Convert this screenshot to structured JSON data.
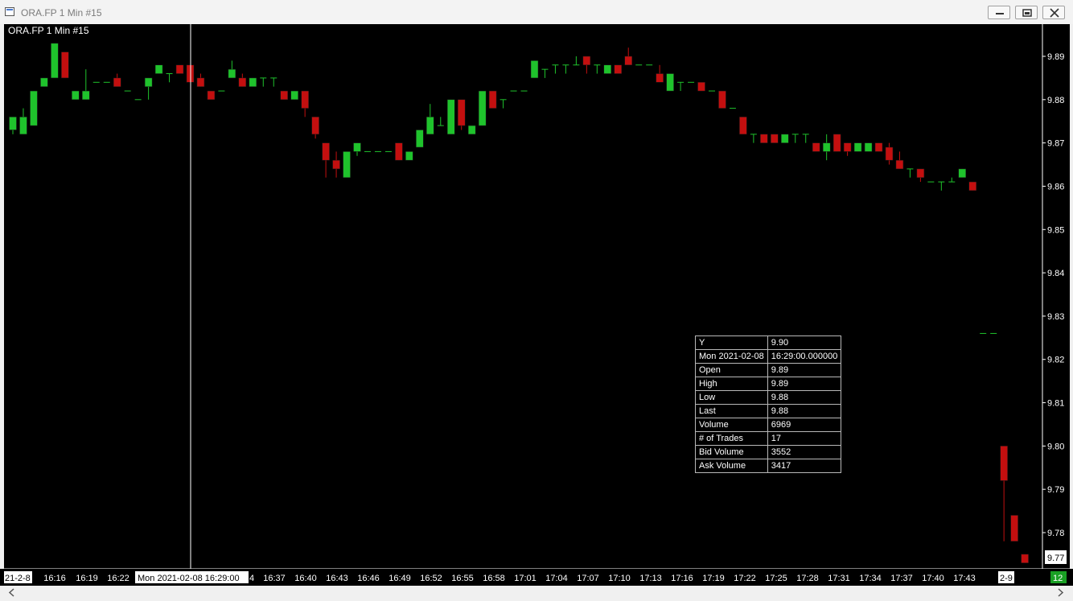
{
  "window": {
    "title": "ORA.FP  1 Min   #15",
    "minimize": "minimize",
    "restore": "restore",
    "close": "close"
  },
  "chart": {
    "label": "ORA.FP  1 Min  #15",
    "price_labels": [
      "9.89",
      "9.88",
      "9.87",
      "9.86",
      "9.85",
      "9.84",
      "9.83",
      "9.82",
      "9.81",
      "9.80",
      "9.79",
      "9.78"
    ],
    "last_price": "9.77",
    "time_labels": [
      "16:16",
      "16:19",
      "16:22",
      "16:37",
      "16:40",
      "16:43",
      "16:46",
      "16:49",
      "16:52",
      "16:55",
      "16:58",
      "17:01",
      "17:04",
      "17:07",
      "17:10",
      "17:13",
      "17:16",
      "17:19",
      "17:22",
      "17:25",
      "17:28",
      "17:31",
      "17:34",
      "17:37",
      "17:40",
      "17:43"
    ],
    "date_left": "21-2-8",
    "date_right": "2-9",
    "cursor_time": "Mon 2021-02-08  16:29:00",
    "cursor_time_suffix": "4",
    "counter": "12",
    "colors": {
      "up": "#1fc32c",
      "down": "#c30f0f",
      "background": "#000000",
      "text": "#ffffff",
      "counter": "#1aa024"
    }
  },
  "chart_data": {
    "type": "candlestick",
    "title": "ORA.FP  1 Min  #15",
    "ylim": [
      9.765,
      9.895
    ],
    "candles": [
      {
        "o": 9.873,
        "h": 9.876,
        "l": 9.872,
        "c": 9.876
      },
      {
        "o": 9.872,
        "h": 9.878,
        "l": 9.872,
        "c": 9.876
      },
      {
        "o": 9.874,
        "h": 9.882,
        "l": 9.874,
        "c": 9.882
      },
      {
        "o": 9.883,
        "h": 9.885,
        "l": 9.883,
        "c": 9.885
      },
      {
        "o": 9.885,
        "h": 9.893,
        "l": 9.885,
        "c": 9.893
      },
      {
        "o": 9.891,
        "h": 9.891,
        "l": 9.885,
        "c": 9.885
      },
      {
        "o": 9.88,
        "h": 9.882,
        "l": 9.88,
        "c": 9.882
      },
      {
        "o": 9.88,
        "h": 9.887,
        "l": 9.88,
        "c": 9.882
      },
      {
        "o": 9.884,
        "h": 9.884,
        "l": 9.884,
        "c": 9.884
      },
      {
        "o": 9.884,
        "h": 9.884,
        "l": 9.884,
        "c": 9.884
      },
      {
        "o": 9.885,
        "h": 9.886,
        "l": 9.883,
        "c": 9.883
      },
      {
        "o": 9.882,
        "h": 9.882,
        "l": 9.882,
        "c": 9.882
      },
      {
        "o": 9.88,
        "h": 9.88,
        "l": 9.88,
        "c": 9.88
      },
      {
        "o": 9.883,
        "h": 9.885,
        "l": 9.88,
        "c": 9.885
      },
      {
        "o": 9.886,
        "h": 9.888,
        "l": 9.886,
        "c": 9.888
      },
      {
        "o": 9.886,
        "h": 9.886,
        "l": 9.884,
        "c": 9.886
      },
      {
        "o": 9.888,
        "h": 9.888,
        "l": 9.886,
        "c": 9.886
      },
      {
        "o": 9.888,
        "h": 9.888,
        "l": 9.884,
        "c": 9.884
      },
      {
        "o": 9.885,
        "h": 9.886,
        "l": 9.883,
        "c": 9.883
      },
      {
        "o": 9.882,
        "h": 9.882,
        "l": 9.88,
        "c": 9.88
      },
      {
        "o": 9.882,
        "h": 9.882,
        "l": 9.882,
        "c": 9.882
      },
      {
        "o": 9.885,
        "h": 9.889,
        "l": 9.885,
        "c": 9.887
      },
      {
        "o": 9.885,
        "h": 9.886,
        "l": 9.883,
        "c": 9.883
      },
      {
        "o": 9.883,
        "h": 9.885,
        "l": 9.883,
        "c": 9.885
      },
      {
        "o": 9.885,
        "h": 9.885,
        "l": 9.883,
        "c": 9.885
      },
      {
        "o": 9.885,
        "h": 9.885,
        "l": 9.883,
        "c": 9.885
      },
      {
        "o": 9.882,
        "h": 9.882,
        "l": 9.88,
        "c": 9.88
      },
      {
        "o": 9.88,
        "h": 9.882,
        "l": 9.88,
        "c": 9.882
      },
      {
        "o": 9.882,
        "h": 9.882,
        "l": 9.876,
        "c": 9.878
      },
      {
        "o": 9.876,
        "h": 9.876,
        "l": 9.871,
        "c": 9.872
      },
      {
        "o": 9.87,
        "h": 9.87,
        "l": 9.862,
        "c": 9.866
      },
      {
        "o": 9.866,
        "h": 9.868,
        "l": 9.862,
        "c": 9.864
      },
      {
        "o": 9.862,
        "h": 9.868,
        "l": 9.862,
        "c": 9.868
      },
      {
        "o": 9.868,
        "h": 9.87,
        "l": 9.867,
        "c": 9.87
      },
      {
        "o": 9.868,
        "h": 9.868,
        "l": 9.868,
        "c": 9.868
      },
      {
        "o": 9.868,
        "h": 9.868,
        "l": 9.868,
        "c": 9.868
      },
      {
        "o": 9.868,
        "h": 9.868,
        "l": 9.868,
        "c": 9.868
      },
      {
        "o": 9.87,
        "h": 9.87,
        "l": 9.866,
        "c": 9.866
      },
      {
        "o": 9.866,
        "h": 9.868,
        "l": 9.866,
        "c": 9.868
      },
      {
        "o": 9.869,
        "h": 9.873,
        "l": 9.869,
        "c": 9.873
      },
      {
        "o": 9.872,
        "h": 9.879,
        "l": 9.872,
        "c": 9.876
      },
      {
        "o": 9.874,
        "h": 9.876,
        "l": 9.874,
        "c": 9.874
      },
      {
        "o": 9.872,
        "h": 9.88,
        "l": 9.872,
        "c": 9.88
      },
      {
        "o": 9.88,
        "h": 9.88,
        "l": 9.873,
        "c": 9.874
      },
      {
        "o": 9.872,
        "h": 9.874,
        "l": 9.872,
        "c": 9.874
      },
      {
        "o": 9.874,
        "h": 9.882,
        "l": 9.874,
        "c": 9.882
      },
      {
        "o": 9.882,
        "h": 9.882,
        "l": 9.878,
        "c": 9.878
      },
      {
        "o": 9.88,
        "h": 9.88,
        "l": 9.878,
        "c": 9.88
      },
      {
        "o": 9.882,
        "h": 9.882,
        "l": 9.882,
        "c": 9.882
      },
      {
        "o": 9.882,
        "h": 9.882,
        "l": 9.882,
        "c": 9.882
      },
      {
        "o": 9.885,
        "h": 9.889,
        "l": 9.885,
        "c": 9.889
      },
      {
        "o": 9.887,
        "h": 9.887,
        "l": 9.885,
        "c": 9.887
      },
      {
        "o": 9.888,
        "h": 9.888,
        "l": 9.886,
        "c": 9.888
      },
      {
        "o": 9.888,
        "h": 9.888,
        "l": 9.886,
        "c": 9.888
      },
      {
        "o": 9.888,
        "h": 9.89,
        "l": 9.888,
        "c": 9.888
      },
      {
        "o": 9.89,
        "h": 9.89,
        "l": 9.886,
        "c": 9.888
      },
      {
        "o": 9.888,
        "h": 9.888,
        "l": 9.886,
        "c": 9.888
      },
      {
        "o": 9.886,
        "h": 9.888,
        "l": 9.886,
        "c": 9.888
      },
      {
        "o": 9.888,
        "h": 9.888,
        "l": 9.886,
        "c": 9.886
      },
      {
        "o": 9.89,
        "h": 9.892,
        "l": 9.888,
        "c": 9.888
      },
      {
        "o": 9.888,
        "h": 9.888,
        "l": 9.888,
        "c": 9.888
      },
      {
        "o": 9.888,
        "h": 9.888,
        "l": 9.888,
        "c": 9.888
      },
      {
        "o": 9.886,
        "h": 9.888,
        "l": 9.884,
        "c": 9.884
      },
      {
        "o": 9.882,
        "h": 9.886,
        "l": 9.882,
        "c": 9.886
      },
      {
        "o": 9.884,
        "h": 9.884,
        "l": 9.882,
        "c": 9.884
      },
      {
        "o": 9.884,
        "h": 9.884,
        "l": 9.884,
        "c": 9.884
      },
      {
        "o": 9.884,
        "h": 9.884,
        "l": 9.882,
        "c": 9.882
      },
      {
        "o": 9.882,
        "h": 9.882,
        "l": 9.882,
        "c": 9.882
      },
      {
        "o": 9.882,
        "h": 9.882,
        "l": 9.878,
        "c": 9.878
      },
      {
        "o": 9.878,
        "h": 9.878,
        "l": 9.878,
        "c": 9.878
      },
      {
        "o": 9.876,
        "h": 9.876,
        "l": 9.872,
        "c": 9.872
      },
      {
        "o": 9.872,
        "h": 9.872,
        "l": 9.87,
        "c": 9.872
      },
      {
        "o": 9.872,
        "h": 9.872,
        "l": 9.87,
        "c": 9.87
      },
      {
        "o": 9.872,
        "h": 9.872,
        "l": 9.87,
        "c": 9.87
      },
      {
        "o": 9.87,
        "h": 9.872,
        "l": 9.87,
        "c": 9.872
      },
      {
        "o": 9.872,
        "h": 9.872,
        "l": 9.87,
        "c": 9.872
      },
      {
        "o": 9.872,
        "h": 9.872,
        "l": 9.87,
        "c": 9.872
      },
      {
        "o": 9.87,
        "h": 9.87,
        "l": 9.868,
        "c": 9.868
      },
      {
        "o": 9.868,
        "h": 9.872,
        "l": 9.866,
        "c": 9.87
      },
      {
        "o": 9.872,
        "h": 9.872,
        "l": 9.868,
        "c": 9.868
      },
      {
        "o": 9.87,
        "h": 9.87,
        "l": 9.867,
        "c": 9.868
      },
      {
        "o": 9.868,
        "h": 9.87,
        "l": 9.868,
        "c": 9.87
      },
      {
        "o": 9.868,
        "h": 9.87,
        "l": 9.868,
        "c": 9.87
      },
      {
        "o": 9.87,
        "h": 9.87,
        "l": 9.868,
        "c": 9.868
      },
      {
        "o": 9.869,
        "h": 9.87,
        "l": 9.865,
        "c": 9.866
      },
      {
        "o": 9.866,
        "h": 9.868,
        "l": 9.864,
        "c": 9.864
      },
      {
        "o": 9.864,
        "h": 9.864,
        "l": 9.862,
        "c": 9.864
      },
      {
        "o": 9.864,
        "h": 9.864,
        "l": 9.861,
        "c": 9.862
      },
      {
        "o": 9.861,
        "h": 9.861,
        "l": 9.861,
        "c": 9.861
      },
      {
        "o": 9.861,
        "h": 9.861,
        "l": 9.859,
        "c": 9.861
      },
      {
        "o": 9.861,
        "h": 9.862,
        "l": 9.861,
        "c": 9.861
      },
      {
        "o": 9.862,
        "h": 9.864,
        "l": 9.862,
        "c": 9.864
      },
      {
        "o": 9.861,
        "h": 9.861,
        "l": 9.859,
        "c": 9.859
      },
      {
        "o": 9.826,
        "h": 9.826,
        "l": 9.826,
        "c": 9.826
      },
      {
        "o": 9.826,
        "h": 9.826,
        "l": 9.826,
        "c": 9.826
      },
      {
        "o": 9.8,
        "h": 9.8,
        "l": 9.778,
        "c": 9.792
      },
      {
        "o": 9.784,
        "h": 9.784,
        "l": 9.778,
        "c": 9.778
      },
      {
        "o": 9.775,
        "h": 9.775,
        "l": 9.773,
        "c": 9.773
      }
    ],
    "tooltip": {
      "y_label": "Y",
      "y_value": "9.90",
      "date": "Mon 2021-02-08",
      "time": "16:29:00.000000",
      "rows": [
        {
          "key": "Open",
          "value": "9.89"
        },
        {
          "key": "High",
          "value": "9.89"
        },
        {
          "key": "Low",
          "value": "9.88"
        },
        {
          "key": "Last",
          "value": "9.88"
        },
        {
          "key": "Volume",
          "value": "6969"
        },
        {
          "key": "# of Trades",
          "value": "17"
        },
        {
          "key": "Bid Volume",
          "value": "3552"
        },
        {
          "key": "Ask Volume",
          "value": "3417"
        }
      ]
    }
  },
  "scrollbar": {
    "left": "scroll-left",
    "right": "scroll-right"
  }
}
